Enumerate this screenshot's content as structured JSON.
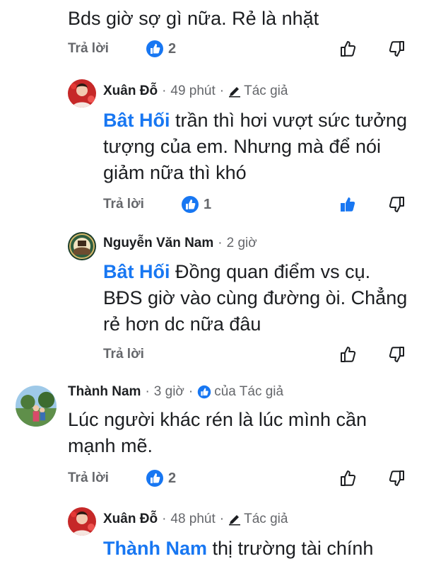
{
  "top_comment": {
    "text": "Bds giờ sợ gì nữa. Rẻ là nhặt",
    "reply_label": "Trả lời",
    "reaction_count": "2"
  },
  "reply1": {
    "author": "Xuân Đỗ",
    "time": "49 phút",
    "author_badge": "Tác giả",
    "mention": "Bât Hối",
    "text_lines": [
      "trần thì hơi vượt sức tưởng",
      "tượng của em. Nhưng mà để nói",
      "giảm nữa thì khó"
    ],
    "reply_label": "Trả lời",
    "reaction_count": "1"
  },
  "reply2": {
    "author": "Nguyễn Văn Nam",
    "time": "2 giờ",
    "mention": "Bât Hối",
    "text_lines": [
      "Đồng quan điểm vs cụ.",
      "BĐS giờ vào cùng đường òi. Chẳng",
      "rẻ hơn dc nữa đâu"
    ],
    "reply_label": "Trả lời"
  },
  "comment2": {
    "author": "Thành Nam",
    "time": "3 giờ",
    "liked_by": "của Tác giả",
    "text_lines": [
      "Lúc người khác rén là lúc mình cần",
      "mạnh mẽ."
    ],
    "reply_label": "Trả lời",
    "reaction_count": "2"
  },
  "reply3": {
    "author": "Xuân Đỗ",
    "time": "48 phút",
    "author_badge": "Tác giả",
    "mention": "Thành Nam",
    "text_line": "thị trường tài chính"
  },
  "colors": {
    "accent": "#1877f2",
    "secondary_text": "#65676b"
  }
}
